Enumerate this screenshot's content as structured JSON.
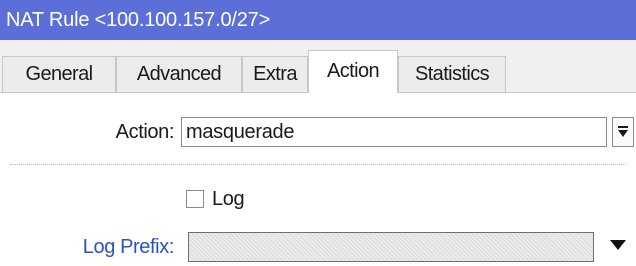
{
  "window": {
    "title": "NAT Rule <100.100.157.0/27>"
  },
  "tabs": [
    {
      "label": "General",
      "active": false
    },
    {
      "label": "Advanced",
      "active": false
    },
    {
      "label": "Extra",
      "active": false
    },
    {
      "label": "Action",
      "active": true
    },
    {
      "label": "Statistics",
      "active": false
    }
  ],
  "form": {
    "action_label": "Action:",
    "action_value": "masquerade",
    "log_label": "Log",
    "log_checked": false,
    "log_prefix_label": "Log Prefix:",
    "log_prefix_value": ""
  },
  "colors": {
    "titlebar": "#5c6fd8",
    "link_label": "#2b52c4"
  },
  "icons": {
    "action_dropdown": "dropdown-arrow-icon",
    "log_prefix_dropdown": "triangle-down-icon"
  }
}
